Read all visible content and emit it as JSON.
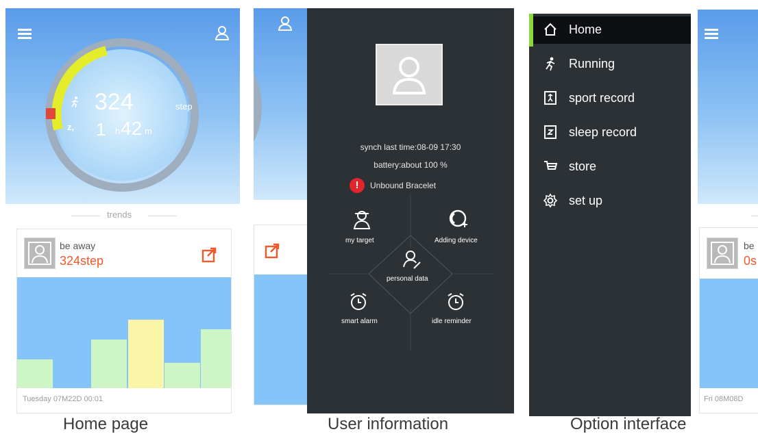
{
  "panel1": {
    "steps": "324",
    "steps_unit": "step",
    "sleep_hours": "1",
    "sleep_h_unit": "h",
    "sleep_minutes": "42",
    "sleep_m_unit": "m",
    "trends_label": "trends",
    "card": {
      "title": "be away",
      "value": "324step",
      "date": "Tuesday 07M22D 00:01"
    },
    "bars": [
      0.26,
      0.44,
      0.62,
      0.23,
      0.53
    ],
    "bar_colors": [
      "#cdf5c5",
      "#cdf5c5",
      "#fbf5a8",
      "#cdf5c5",
      "#cdf5c5"
    ],
    "caption": "Home page"
  },
  "panel2": {
    "synch_text": "synch last time:08-09 17:30",
    "battery_text": "battery:about 100 %",
    "unbound_text": "Unbound Bracelet",
    "features": {
      "my_target": "my target",
      "adding_device": "Adding device",
      "personal_data": "personal data",
      "smart_alarm": "smart alarm",
      "idle_reminder": "idle reminder"
    },
    "caption": "User information"
  },
  "panel3": {
    "menu": [
      "Home",
      "Running",
      "sport record",
      "sleep record",
      "store",
      "set up"
    ],
    "active_index": 0,
    "accent_color": "#8bd63a",
    "caption": "Option interface"
  },
  "panel4": {
    "card_title": "be",
    "card_value": "0s",
    "date": "Fri 08M08D"
  }
}
